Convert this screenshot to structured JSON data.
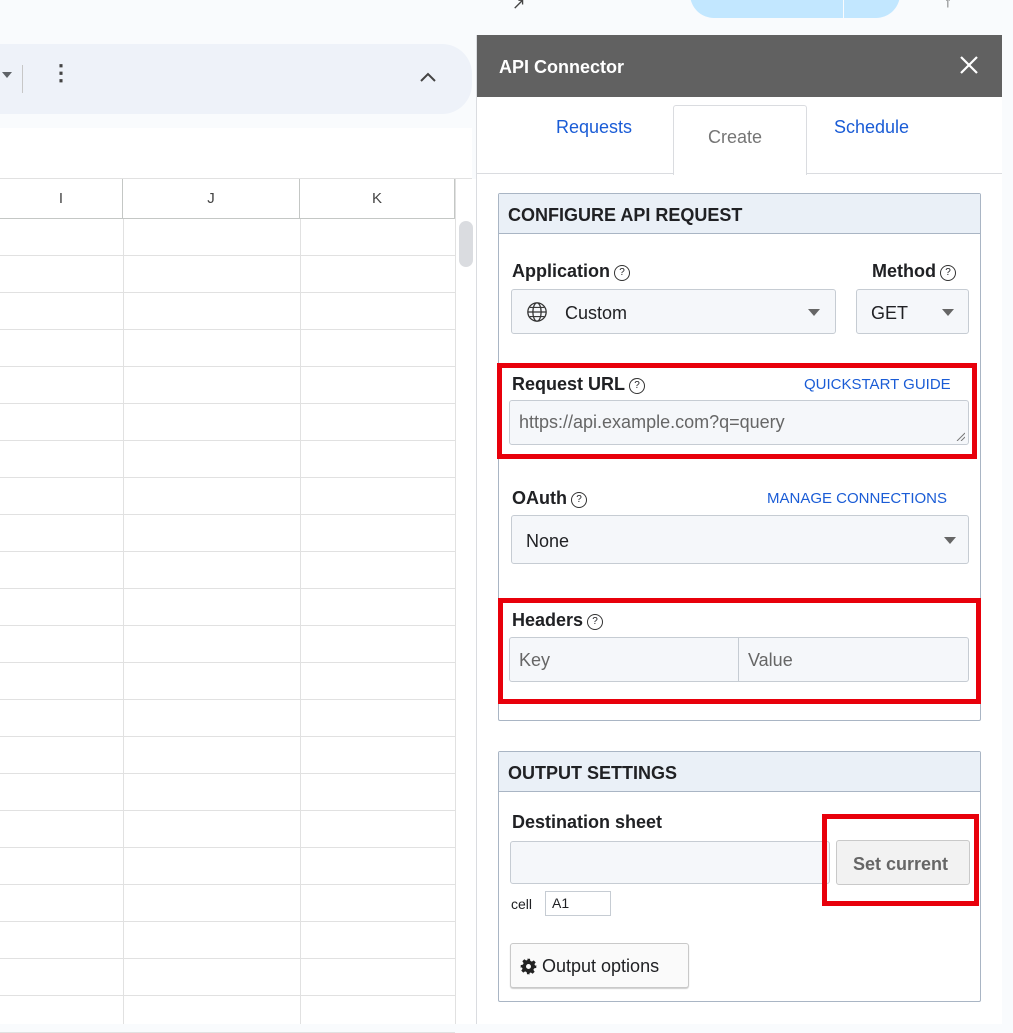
{
  "app": {
    "sheet_columns": [
      "I",
      "J",
      "K"
    ]
  },
  "panel": {
    "title": "API Connector",
    "tabs": [
      {
        "label": "Requests",
        "active": false
      },
      {
        "label": "Create",
        "active": true
      },
      {
        "label": "Schedule",
        "active": false
      }
    ],
    "configure": {
      "heading": "CONFIGURE API REQUEST",
      "application_label": "Application",
      "application_value": "Custom",
      "method_label": "Method",
      "method_value": "GET",
      "request_url_label": "Request URL",
      "quickstart_link": "QUICKSTART GUIDE",
      "request_url_placeholder": "https://api.example.com?q=query",
      "oauth_label": "OAuth",
      "manage_connections_link": "MANAGE CONNECTIONS",
      "oauth_value": "None",
      "headers_label": "Headers",
      "header_key_placeholder": "Key",
      "header_value_placeholder": "Value"
    },
    "output": {
      "heading": "OUTPUT SETTINGS",
      "destination_label": "Destination sheet",
      "set_current_button": "Set current",
      "cell_label": "cell",
      "cell_value": "A1",
      "output_options_button": "Output options"
    }
  },
  "colors": {
    "panel_header": "#616161",
    "link": "#1a5cd6",
    "highlight": "#e8000b",
    "section_head": "#eaf0f7"
  }
}
